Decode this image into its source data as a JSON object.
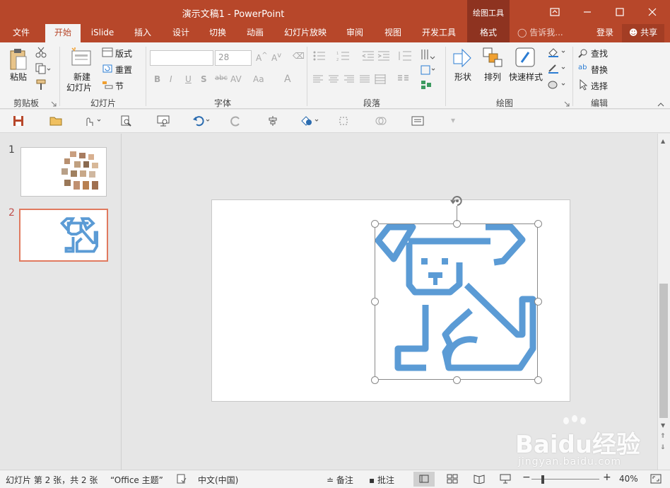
{
  "window": {
    "title": "演示文稿1 - PowerPoint",
    "context_tab_group": "绘图工具"
  },
  "tabs": {
    "file": "文件",
    "home": "开始",
    "islide": "iSlide",
    "insert": "插入",
    "design": "设计",
    "transitions": "切换",
    "animations": "动画",
    "slideshow": "幻灯片放映",
    "review": "审阅",
    "view": "视图",
    "developer": "开发工具",
    "format": "格式",
    "tell_me": "告诉我...",
    "signin": "登录",
    "share": "共享"
  },
  "ribbon": {
    "clipboard": {
      "paste": "粘贴",
      "label": "剪贴板"
    },
    "slides": {
      "new_slide_l1": "新建",
      "new_slide_l2": "幻灯片",
      "layout": "版式",
      "reset": "重置",
      "section": "节",
      "label": "幻灯片"
    },
    "font": {
      "font_name": "",
      "font_size": "28",
      "label": "字体"
    },
    "paragraph": {
      "label": "段落"
    },
    "drawing": {
      "shapes": "形状",
      "arrange": "排列",
      "quick_styles": "快速样式",
      "label": "绘图"
    },
    "editing": {
      "find": "查找",
      "replace": "替换",
      "select": "选择",
      "label": "编辑"
    }
  },
  "slides_pane": {
    "slides": [
      {
        "number": "1"
      },
      {
        "number": "2"
      }
    ]
  },
  "status": {
    "slide_info": "幻灯片 第 2 张，共 2 张",
    "theme": "“Office 主题”",
    "language": "中文(中国)",
    "notes": "备注",
    "comments": "批注",
    "zoom": "40%"
  },
  "watermark": {
    "brand": "Baidu经验",
    "url": "jingyan.baidu.com"
  },
  "colors": {
    "accent": "#b7472a",
    "accent_dark": "#8e3320",
    "dog_icon": "#5b9bd5",
    "selected_thumb": "#e07a5f"
  }
}
